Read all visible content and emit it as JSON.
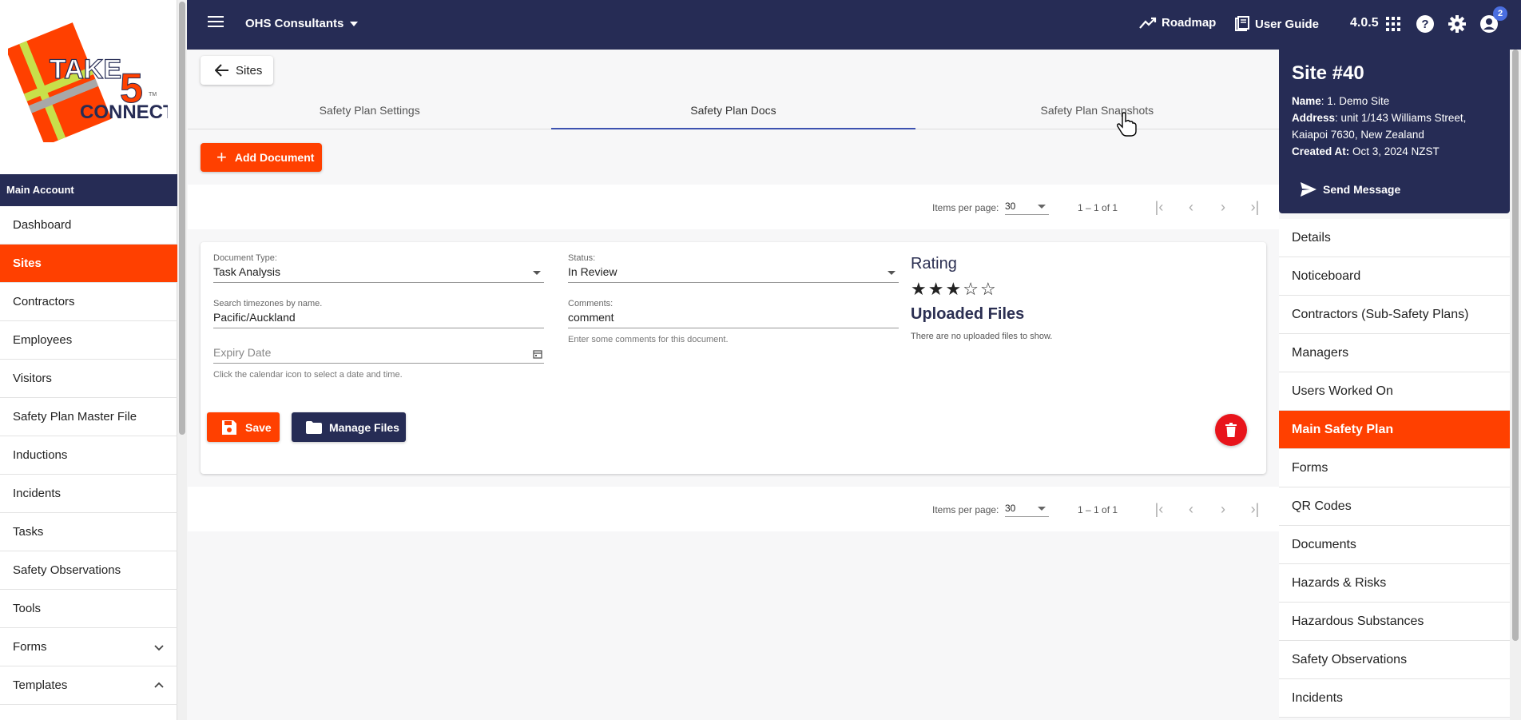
{
  "brand": {
    "logo_top_text": "TAKE",
    "logo_number": "5",
    "logo_bottom_text": "CONNECT",
    "logo_tm": "TM",
    "primary_color": "#262c55",
    "accent_color": "#ff4000",
    "danger_color": "#e8141b"
  },
  "sidebar": {
    "account_header": "Main Account",
    "items": [
      {
        "label": "Dashboard",
        "active": false
      },
      {
        "label": "Sites",
        "active": true
      },
      {
        "label": "Contractors",
        "active": false
      },
      {
        "label": "Employees",
        "active": false
      },
      {
        "label": "Visitors",
        "active": false
      },
      {
        "label": "Safety Plan Master File",
        "active": false
      },
      {
        "label": "Inductions",
        "active": false
      },
      {
        "label": "Incidents",
        "active": false
      },
      {
        "label": "Tasks",
        "active": false
      },
      {
        "label": "Safety Observations",
        "active": false
      },
      {
        "label": "Tools",
        "active": false
      },
      {
        "label": "Forms",
        "active": false,
        "expand_icon": "chevron-down-icon"
      },
      {
        "label": "Templates",
        "active": false,
        "expand_icon": "chevron-up-icon"
      }
    ]
  },
  "topbar": {
    "org_name": "OHS Consultants",
    "roadmap_label": "Roadmap",
    "user_guide_label": "User Guide",
    "version": "4.0.5",
    "notification_count": "2",
    "icons": [
      "menu-icon",
      "trending-icon",
      "book-icon",
      "apps-grid-icon",
      "help-icon",
      "settings-icon",
      "account-icon"
    ]
  },
  "main": {
    "back_label": "Sites",
    "tabs": [
      {
        "label": "Safety Plan Settings",
        "active": false
      },
      {
        "label": "Safety Plan Docs",
        "active": true
      },
      {
        "label": "Safety Plan Snapshots",
        "active": false
      }
    ],
    "add_document_label": "Add Document",
    "paginator_top": {
      "items_per_page_label": "Items per page:",
      "items_per_page": "30",
      "range": "1 – 1 of 1"
    },
    "paginator_bottom": {
      "items_per_page_label": "Items per page:",
      "items_per_page": "30",
      "range": "1 – 1 of 1"
    },
    "document": {
      "doc_type_label": "Document Type:",
      "doc_type_value": "Task Analysis",
      "status_label": "Status:",
      "status_value": "In Review",
      "timezone_label": "Search timezones by name.",
      "timezone_value": "Pacific/Auckland",
      "comments_label": "Comments:",
      "comments_value": "comment",
      "comments_hint": "Enter some comments for this document.",
      "expiry_placeholder": "Expiry Date",
      "expiry_hint": "Click the calendar icon to select a date and time.",
      "rating_title": "Rating",
      "rating_value": 3,
      "rating_max": 5,
      "uploaded_title": "Uploaded Files",
      "uploaded_empty": "There are no uploaded files to show.",
      "save_label": "Save",
      "manage_files_label": "Manage Files"
    }
  },
  "site_panel": {
    "title": "Site #40",
    "name_label": "Name",
    "name_value": ": 1. Demo Site",
    "address_label": "Address",
    "address_value": ": unit 1/143 Williams Street, Kaiapoi 7630, New Zealand",
    "created_label": "Created At:",
    "created_value": " Oct 3, 2024 NZST",
    "send_message_label": "Send Message"
  },
  "right_nav": {
    "items": [
      {
        "label": "Details",
        "active": false
      },
      {
        "label": "Noticeboard",
        "active": false
      },
      {
        "label": "Contractors (Sub-Safety Plans)",
        "active": false
      },
      {
        "label": "Managers",
        "active": false
      },
      {
        "label": "Users Worked On",
        "active": false
      },
      {
        "label": "Main Safety Plan",
        "active": true
      },
      {
        "label": "Forms",
        "active": false
      },
      {
        "label": "QR Codes",
        "active": false
      },
      {
        "label": "Documents",
        "active": false
      },
      {
        "label": "Hazards & Risks",
        "active": false
      },
      {
        "label": "Hazardous Substances",
        "active": false
      },
      {
        "label": "Safety Observations",
        "active": false
      },
      {
        "label": "Incidents",
        "active": false
      }
    ]
  }
}
